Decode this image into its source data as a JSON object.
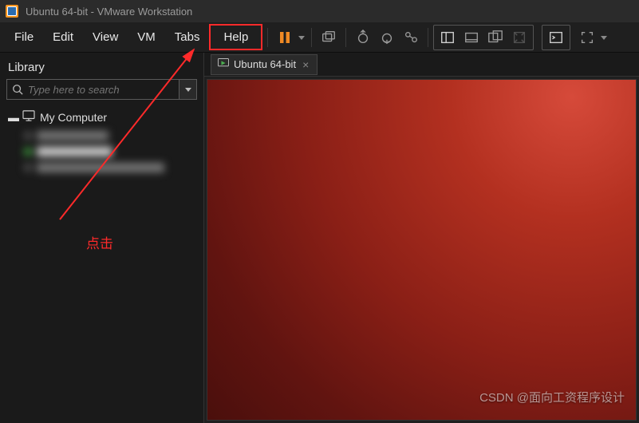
{
  "titlebar": {
    "title": "Ubuntu 64-bit - VMware Workstation"
  },
  "menu": {
    "file": "File",
    "edit": "Edit",
    "view": "View",
    "vm": "VM",
    "tabs": "Tabs",
    "help": "Help"
  },
  "toolbar": {
    "pause": "pause",
    "snapshot": "snapshot",
    "revert": "revert",
    "manage": "manage-snapshots",
    "layout1": "single-window",
    "layout2": "multi-monitor",
    "layout3": "unity",
    "layout4": "fullscreen-stretch",
    "console": "console",
    "fullscreen": "fullscreen"
  },
  "library": {
    "title": "Library",
    "search_placeholder": "Type here to search",
    "root": "My Computer"
  },
  "tab": {
    "label": "Ubuntu 64-bit",
    "close": "×"
  },
  "annotation": {
    "text": "点击"
  },
  "watermark": {
    "text": "CSDN @面向工资程序设计"
  }
}
